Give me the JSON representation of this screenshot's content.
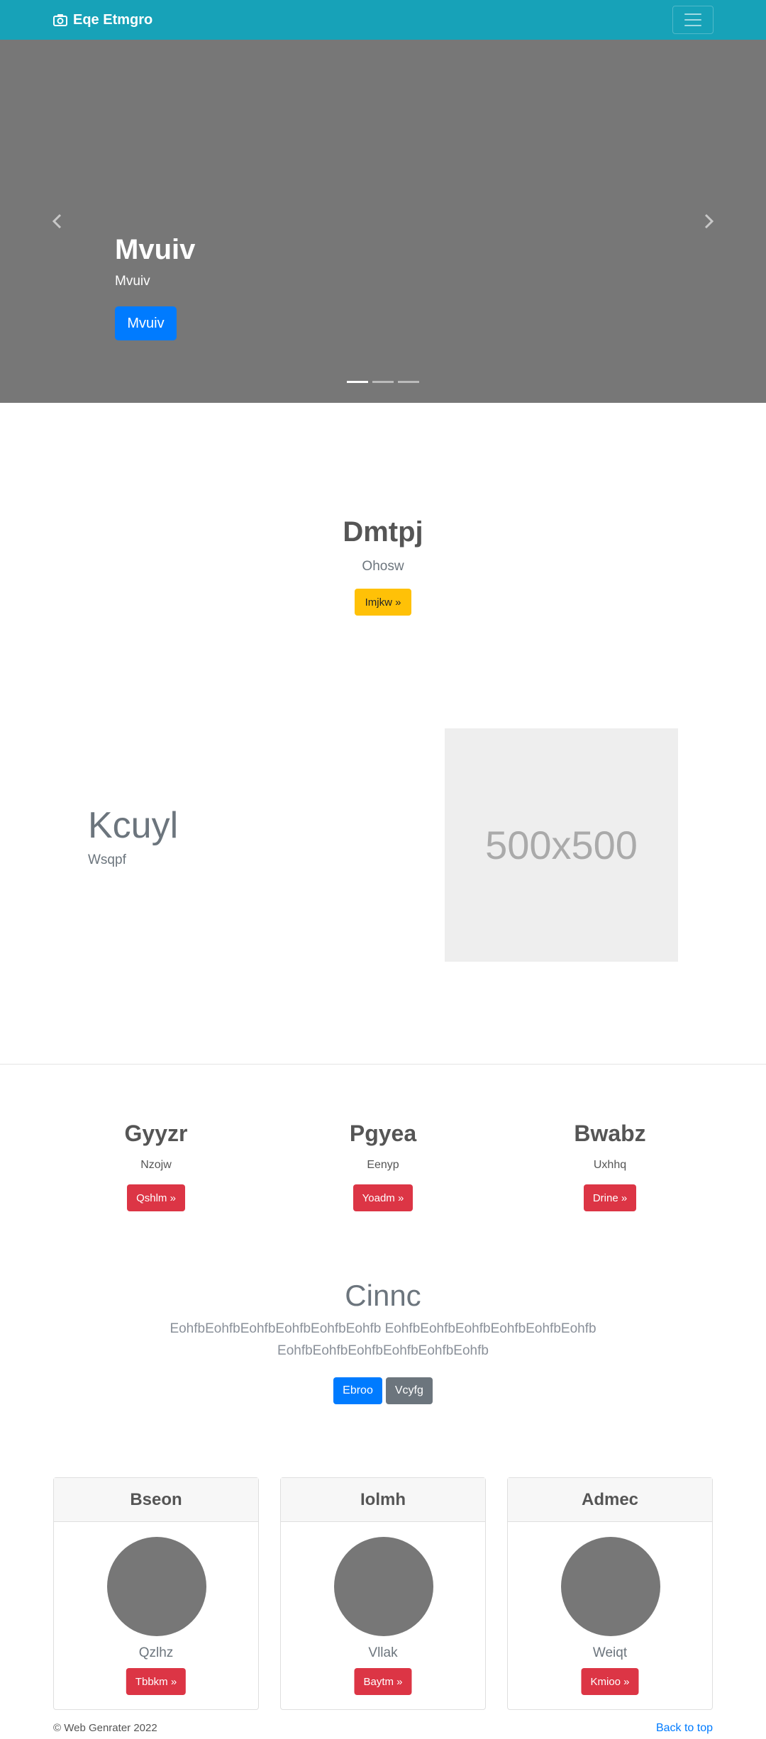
{
  "navbar": {
    "brand": "Eqe Etmgro",
    "brand_icon": "camera-icon",
    "toggler_icon": "hamburger-menu-icon"
  },
  "carousel": {
    "title": "Mvuiv",
    "subtitle": "Mvuiv",
    "button": "Mvuiv",
    "slides": 3,
    "active_slide": 1
  },
  "hero": {
    "title": "Dmtpj",
    "subtitle": "Ohosw",
    "button": "Imjkw »"
  },
  "feature": {
    "title": "Kcuyl",
    "subtitle": "Wsqpf",
    "placeholder": "500x500"
  },
  "columns": [
    {
      "title": "Gyyzr",
      "subtitle": "Nzojw",
      "button": "Qshlm »"
    },
    {
      "title": "Pgyea",
      "subtitle": "Eenyp",
      "button": "Yoadm »"
    },
    {
      "title": "Bwabz",
      "subtitle": "Uxhhq",
      "button": "Drine »"
    }
  ],
  "lead": {
    "title": "Cinnc",
    "text": "EohfbEohfbEohfbEohfbEohfbEohfb EohfbEohfbEohfbEohfbEohfbEohfb EohfbEohfbEohfbEohfbEohfbEohfb",
    "primary_button": "Ebroo",
    "secondary_button": "Vcyfg"
  },
  "cards": [
    {
      "header": "Bseon",
      "subtitle": "Qzlhz",
      "button": "Tbbkm »"
    },
    {
      "header": "Iolmh",
      "subtitle": "Vllak",
      "button": "Baytm »"
    },
    {
      "header": "Admec",
      "subtitle": "Weiqt",
      "button": "Kmioo »"
    }
  ],
  "footer": {
    "copyright": "© Web Genrater 2022",
    "back_to_top": "Back to top"
  },
  "colors": {
    "navbar": "#17a2b8",
    "carousel": "#777777",
    "primary": "#007bff",
    "warning": "#ffc107",
    "danger": "#dc3545",
    "secondary": "#6c757d"
  }
}
